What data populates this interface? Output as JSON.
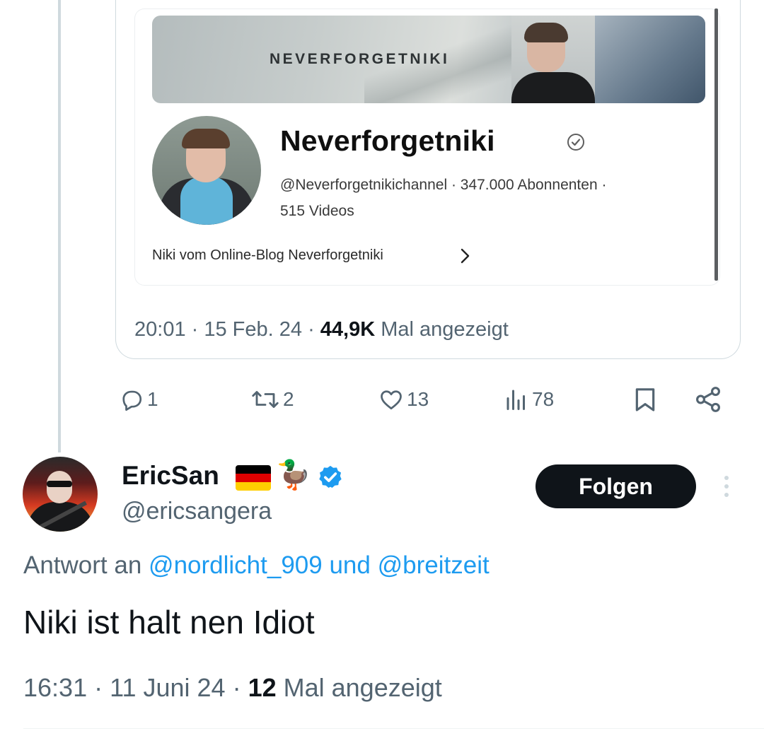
{
  "quoted_tweet": {
    "embed": {
      "banner_text": "NEVERFORGETNIKI",
      "channel_name": "Neverforgetniki",
      "channel_meta_line1": "@Neverforgetnikichannel · 347.000 Abonnenten ·",
      "channel_meta_line2": "515 Videos",
      "channel_description": "Niki vom Online-Blog Neverforgetniki"
    },
    "time": "20:01",
    "date": "15 Feb. 24",
    "views_count": "44,9K",
    "views_label": "Mal angezeigt"
  },
  "actions": {
    "replies": "1",
    "retweets": "2",
    "likes": "13",
    "views": "78"
  },
  "reply_tweet": {
    "display_name": "EricSan",
    "handle": "@ericsangera",
    "follow_label": "Folgen",
    "reply_prefix": "Antwort an",
    "mention1": "@nordlicht_909",
    "reply_and": "und",
    "mention2": "@breitzeit",
    "text": "Niki ist halt nen Idiot",
    "time": "16:31",
    "date": "11 Juni 24",
    "views_count": "12",
    "views_label": "Mal angezeigt"
  },
  "colors": {
    "accent": "#1d9bf0",
    "secondary_text": "#536471",
    "primary_text": "#0f1419"
  },
  "icons": [
    "reply-icon",
    "retweet-icon",
    "like-icon",
    "views-icon",
    "bookmark-icon",
    "share-icon",
    "verified-icon",
    "more-icon",
    "chevron-right-icon"
  ]
}
